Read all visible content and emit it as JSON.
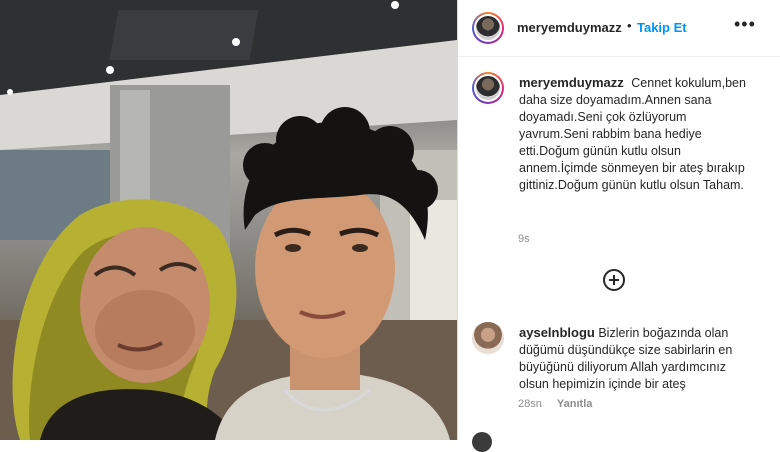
{
  "post": {
    "username": "meryemduymazz",
    "separator": "•",
    "follow_label": "Takip Et",
    "more_icon": "more-options-icon",
    "more_glyph": "•••"
  },
  "caption": {
    "username": "meryemduymazz",
    "text": "Cennet kokulum,ben daha size doyamadım.Annen sana doyamadı.Seni çok özlüyorum yavrum.Seni rabbim bana hediye etti.Doğum günün kutlu olsun annem.İçimde sönmeyen bir ateş bırakıp gittiniz.Doğum günün kutlu olsun Taham.",
    "time": "9s"
  },
  "load_more_icon": "plus-circle-icon",
  "comments": [
    {
      "username": "ayselnblogu",
      "text": "Bizlerin boğazında olan düğümü düşündükçe size sabirlarin en büyüğünü diliyorum Allah yardımcınız olsun hepimizin içinde bir ateş",
      "time": "28sn",
      "reply_label": "Yanıtla"
    }
  ],
  "colors": {
    "accent": "#0095f6",
    "text": "#262626",
    "muted": "#8e8e8e"
  }
}
